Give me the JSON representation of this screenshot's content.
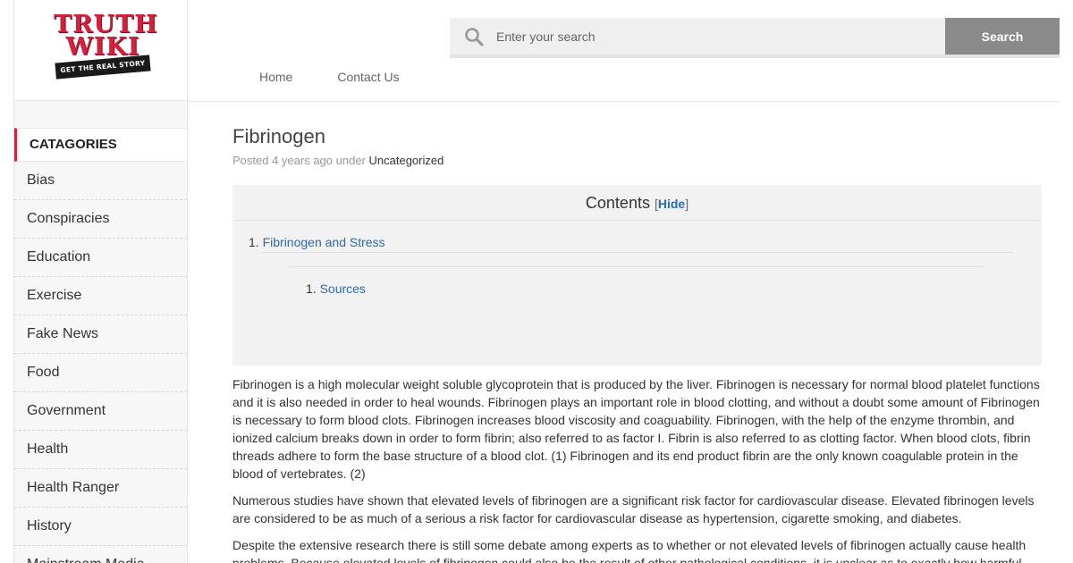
{
  "logo": {
    "line1": "TRUTH",
    "line2": "WIKI",
    "tagline": "GET THE REAL STORY"
  },
  "search": {
    "placeholder": "Enter your search",
    "button_label": "Search"
  },
  "nav": {
    "items": [
      "Home",
      "Contact Us"
    ]
  },
  "sidebar": {
    "heading": "CATAGORIES",
    "items": [
      "Bias",
      "Conspiracies",
      "Education",
      "Exercise",
      "Fake News",
      "Food",
      "Government",
      "Health",
      "Health Ranger",
      "History",
      "Mainstream Media"
    ]
  },
  "post": {
    "title": "Fibrinogen",
    "meta_prefix": "Posted 4 years ago under",
    "category": "Uncategorized"
  },
  "toc": {
    "title": "Contents",
    "toggle_label": "Hide",
    "items": [
      {
        "number": "1.",
        "label": "Fibrinogen and Stress"
      },
      {
        "number": "1.",
        "label": "Sources"
      }
    ]
  },
  "body": {
    "paragraphs": [
      "Fibrinogen is a high molecular weight soluble glycoprotein that is produced by the liver. Fibrinogen is necessary for normal blood platelet functions and it is also needed in order to heal wounds. Fibrinogen plays an important role in blood clotting, and without a doubt some amount of Fibrinogen is necessary to form blood clots. Fibrinogen increases blood viscosity and coaguability. Fibrinogen, with the help of the enzyme thrombin, and ionized calcium breaks down in order to form fibrin; also referred to as factor I. Fibrin is also referred to as clotting factor. When blood clots, fibrin threads adhere to form the base structure of a blood clot. (1) Fibrinogen and its end product fibrin are the only known coagulable protein in the blood of vertebrates. (2)",
      "Numerous studies have shown that elevated levels of fibrinogen are a significant risk factor for cardiovascular disease. Elevated fibrinogen levels are considered to be as much of a serious a risk factor for cardiovascular disease as hypertension, cigarette smoking, and diabetes.",
      "Despite the extensive research there is still some debate among experts as to whether or not elevated levels of fibrinogen actually cause health problems. Because elevated levels of fibrinogen could also be the result of other pathological conditions, it is unclear as to exactly how harmful"
    ]
  }
}
